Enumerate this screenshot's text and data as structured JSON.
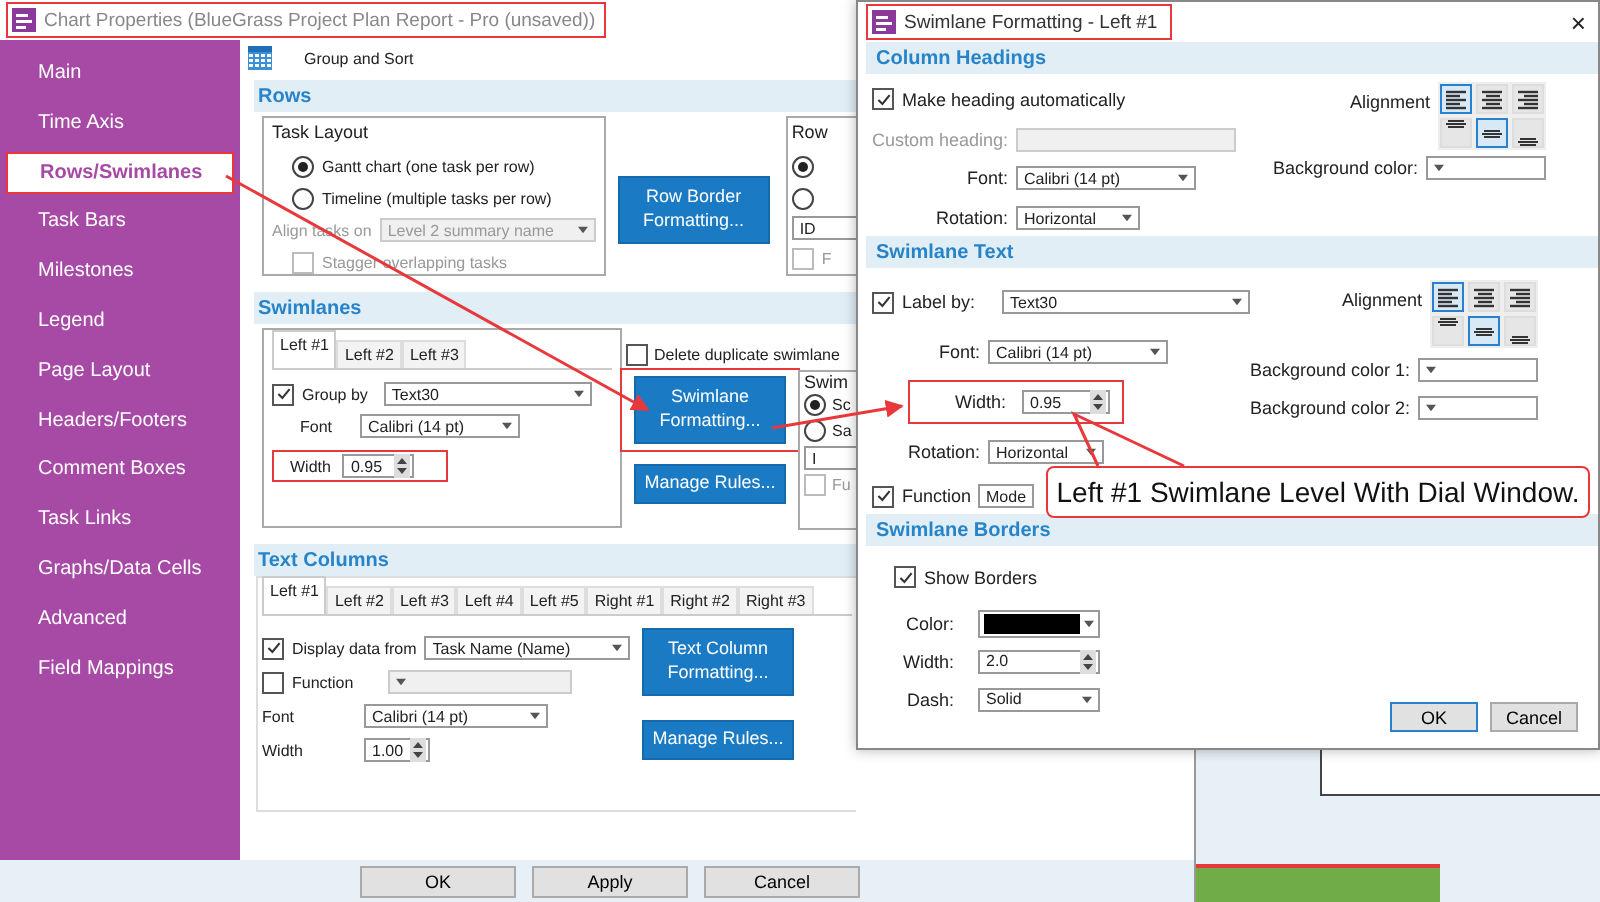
{
  "main_window": {
    "title": "Chart Properties (BlueGrass Project Plan Report - Pro (unsaved))"
  },
  "sidebar": {
    "items": [
      {
        "label": "Main",
        "selected": false
      },
      {
        "label": "Time Axis",
        "selected": false
      },
      {
        "label": "Rows/Swimlanes",
        "selected": true
      },
      {
        "label": "Task Bars",
        "selected": false
      },
      {
        "label": "Milestones",
        "selected": false
      },
      {
        "label": "Legend",
        "selected": false
      },
      {
        "label": "Page Layout",
        "selected": false
      },
      {
        "label": "Headers/Footers",
        "selected": false
      },
      {
        "label": "Comment Boxes",
        "selected": false
      },
      {
        "label": "Task Links",
        "selected": false
      },
      {
        "label": "Graphs/Data Cells",
        "selected": false
      },
      {
        "label": "Advanced",
        "selected": false
      },
      {
        "label": "Field Mappings",
        "selected": false
      }
    ]
  },
  "toolbar": {
    "label": "Group and Sort"
  },
  "rows": {
    "title": "Rows",
    "task_layout": {
      "title": "Task Layout",
      "options": [
        {
          "label": "Gantt chart (one task per row)",
          "selected": true
        },
        {
          "label": "Timeline (multiple tasks per row)",
          "selected": false
        }
      ],
      "align_label": "Align tasks on",
      "align_value": "Level 2 summary name",
      "stagger": {
        "label": "Stagger overlapping tasks",
        "checked": false
      }
    },
    "button": "Row Border Formatting...",
    "group": {
      "title": "Row",
      "options": [
        {
          "selected": true
        },
        {
          "selected": false
        }
      ],
      "field": "ID",
      "checkbox": {
        "label": "F",
        "checked": false
      }
    }
  },
  "swimlanes": {
    "title": "Swimlanes",
    "tabs": [
      {
        "label": "Left #1",
        "selected": true
      },
      {
        "label": "Left #2",
        "selected": false
      },
      {
        "label": "Left #3",
        "selected": false
      }
    ],
    "delete_duplicate": {
      "label": "Delete duplicate swimlane",
      "checked": false
    },
    "group_by": {
      "label": "Group by",
      "checked": true,
      "value": "Text30"
    },
    "font": {
      "label": "Font",
      "value": "Calibri (14 pt)"
    },
    "width": {
      "label": "Width",
      "value": "0.95"
    },
    "buttons": [
      "Swimlane Formatting...",
      "Manage Rules..."
    ],
    "group": {
      "title": "Swim",
      "options": [
        {
          "label": "Sc",
          "selected": true
        },
        {
          "label": "Sa",
          "selected": false
        }
      ],
      "field": "I",
      "checkbox": {
        "label": "Fu",
        "checked": false
      }
    }
  },
  "text_columns": {
    "title": "Text Columns",
    "tabs": [
      {
        "label": "Left #1",
        "selected": true
      },
      {
        "label": "Left #2",
        "selected": false
      },
      {
        "label": "Left #3",
        "selected": false
      },
      {
        "label": "Left #4",
        "selected": false
      },
      {
        "label": "Left #5",
        "selected": false
      },
      {
        "label": "Right #1",
        "selected": false
      },
      {
        "label": "Right #2",
        "selected": false
      },
      {
        "label": "Right #3",
        "selected": false
      }
    ],
    "display": {
      "label": "Display data from",
      "checked": true,
      "value": "Task Name (Name)"
    },
    "function": {
      "label": "Function",
      "checked": false
    },
    "font": {
      "label": "Font",
      "value": "Calibri (14 pt)"
    },
    "width": {
      "label": "Width",
      "value": "1.00"
    },
    "buttons": [
      "Text Column Formatting...",
      "Manage Rules..."
    ]
  },
  "footer_buttons": [
    "OK",
    "Apply",
    "Cancel"
  ],
  "dialog": {
    "title": "Swimlane Formatting - Left #1",
    "close": "×",
    "column_headings": {
      "title": "Column Headings",
      "auto": {
        "label": "Make heading automatically",
        "checked": true
      },
      "custom_label": "Custom heading:",
      "font": {
        "label": "Font:",
        "value": "Calibri (14 pt)"
      },
      "rotation": {
        "label": "Rotation:",
        "value": "Horizontal"
      },
      "alignment": {
        "label": "Alignment",
        "horizontal": [
          {
            "selected": true
          },
          {
            "selected": false
          },
          {
            "selected": false
          }
        ],
        "vertical": [
          {
            "selected": false
          },
          {
            "selected": true
          },
          {
            "selected": false
          }
        ]
      },
      "background_label": "Background color:"
    },
    "swimlane_text": {
      "title": "Swimlane Text",
      "label_by": {
        "label": "Label by:",
        "checked": true,
        "value": "Text30"
      },
      "alignment": {
        "label": "Alignment",
        "horizontal": [
          {
            "selected": true
          },
          {
            "selected": false
          },
          {
            "selected": false
          }
        ],
        "vertical": [
          {
            "selected": false
          },
          {
            "selected": true
          },
          {
            "selected": false
          }
        ]
      },
      "font": {
        "label": "Font:",
        "value": "Calibri (14 pt)"
      },
      "width": {
        "label": "Width:",
        "value": "0.95"
      },
      "background_1": "Background color 1:",
      "rotation": {
        "label": "Rotation:",
        "value": "Horizontal"
      },
      "background_2": "Background color 2:",
      "function": {
        "label": "Function",
        "checked": true,
        "value": "Mode"
      }
    },
    "borders": {
      "title": "Swimlane Borders",
      "show": {
        "label": "Show Borders",
        "checked": true
      },
      "color": {
        "label": "Color:",
        "color": "#000000"
      },
      "width": {
        "label": "Width:",
        "value": "2.0"
      },
      "dash": {
        "label": "Dash:",
        "value": "Solid"
      }
    },
    "buttons": [
      {
        "label": "OK",
        "default": true
      },
      {
        "label": "Cancel",
        "default": false
      }
    ]
  },
  "callout": {
    "text": "Left #1 Swimlane Level With Dial Window."
  }
}
